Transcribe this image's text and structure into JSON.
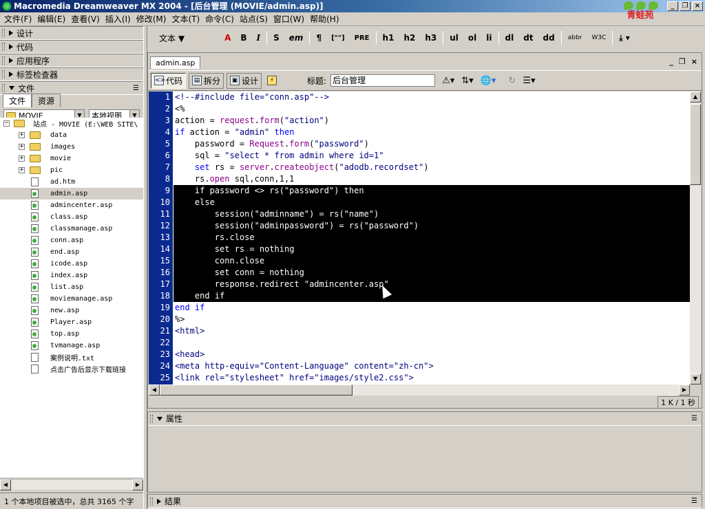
{
  "app": {
    "title": "Macromedia Dreamweaver MX 2004 - [后台管理 (MOVIE/admin.asp)]",
    "logo_text": "青蛙苑"
  },
  "menu": [
    "文件(F)",
    "编辑(E)",
    "查看(V)",
    "插入(I)",
    "修改(M)",
    "文本(T)",
    "命令(C)",
    "站点(S)",
    "窗口(W)",
    "帮助(H)"
  ],
  "panels": {
    "design": "设计",
    "code": "代码",
    "application": "应用程序",
    "tag_inspector": "标签检查器",
    "files": "文件"
  },
  "files_panel": {
    "tabs": [
      "文件",
      "资源"
    ],
    "site_select": "MOVIE",
    "view_select": "本地视图",
    "root": "站点 - MOVIE (E:\\WEB SITE\\",
    "items": [
      {
        "name": "data",
        "type": "folder"
      },
      {
        "name": "images",
        "type": "folder"
      },
      {
        "name": "movie",
        "type": "folder"
      },
      {
        "name": "pic",
        "type": "folder"
      },
      {
        "name": "ad.htm",
        "type": "file"
      },
      {
        "name": "admin.asp",
        "type": "asp",
        "selected": true
      },
      {
        "name": "admincenter.asp",
        "type": "asp"
      },
      {
        "name": "class.asp",
        "type": "asp"
      },
      {
        "name": "classmanage.asp",
        "type": "asp"
      },
      {
        "name": "conn.asp",
        "type": "asp"
      },
      {
        "name": "end.asp",
        "type": "asp"
      },
      {
        "name": "icode.asp",
        "type": "asp"
      },
      {
        "name": "index.asp",
        "type": "asp"
      },
      {
        "name": "list.asp",
        "type": "asp"
      },
      {
        "name": "moviemanage.asp",
        "type": "asp"
      },
      {
        "name": "new.asp",
        "type": "asp"
      },
      {
        "name": "Player.asp",
        "type": "asp"
      },
      {
        "name": "top.asp",
        "type": "asp"
      },
      {
        "name": "tvmanage.asp",
        "type": "asp"
      },
      {
        "name": "案例说明.txt",
        "type": "file"
      },
      {
        "name": "点击广告后显示下载链接",
        "type": "file"
      }
    ],
    "status": "1 个本地项目被选中，总共 3165 个字"
  },
  "toolbar": {
    "text_menu": "文本",
    "buttons": [
      "A",
      "B",
      "I",
      "S",
      "em",
      "¶",
      "[\"\"]",
      "PRE",
      "h1",
      "h2",
      "h3",
      "ul",
      "ol",
      "li",
      "dl",
      "dt",
      "dd",
      "abbr",
      "W3C"
    ]
  },
  "document": {
    "tab": "admin.asp",
    "view_code": "代码",
    "view_split": "拆分",
    "view_design": "设计",
    "title_label": "标题:",
    "title_value": "后台管理",
    "size_info": "1 K / 1 秒",
    "code_lines": [
      "<!--#include file=\"conn.asp\"-->",
      "<%",
      "action = request.form(\"action\")",
      "if action = \"admin\" then",
      "    password = Request.form(\"password\")",
      "    sql = \"select * from admin where id=1\"",
      "    set rs = server.createobject(\"adodb.recordset\")",
      "    rs.open sql,conn,1,1",
      "    if password <> rs(\"password\") then",
      "    else",
      "        session(\"adminname\") = rs(\"name\")",
      "        session(\"adminpassword\") = rs(\"password\")",
      "        rs.close",
      "        set rs = nothing",
      "        conn.close",
      "        set conn = nothing",
      "        response.redirect \"admincenter.asp\"",
      "    end if",
      "end if",
      "%>",
      "<html>",
      "",
      "<head>",
      "<meta http-equiv=\"Content-Language\" content=\"zh-cn\">",
      "<link rel=\"stylesheet\" href=\"images/style2.css\">"
    ],
    "highlight_from": 9,
    "highlight_to": 18
  },
  "properties": {
    "label": "属性"
  },
  "results": {
    "label": "结果"
  }
}
